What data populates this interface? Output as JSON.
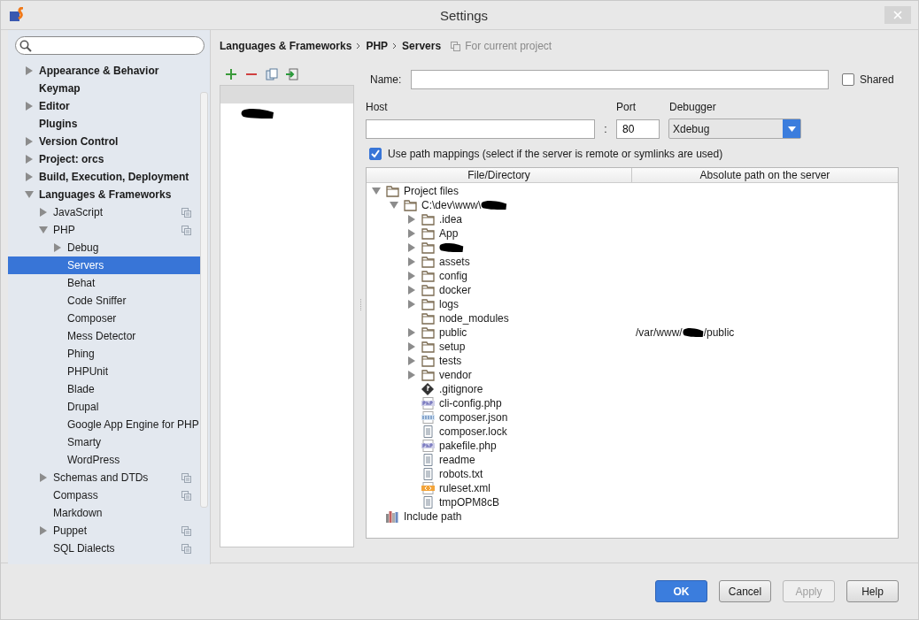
{
  "window": {
    "title": "Settings"
  },
  "sidebar": {
    "items": [
      {
        "label": "Appearance & Behavior",
        "expanded": false
      },
      {
        "label": "Keymap"
      },
      {
        "label": "Editor",
        "expanded": false
      },
      {
        "label": "Plugins"
      },
      {
        "label": "Version Control",
        "expanded": false
      },
      {
        "label": "Project: orcs",
        "expanded": false
      },
      {
        "label": "Build, Execution, Deployment",
        "expanded": false
      },
      {
        "label": "Languages & Frameworks",
        "expanded": true,
        "children": [
          {
            "label": "JavaScript",
            "expanded": false,
            "project_level": true
          },
          {
            "label": "PHP",
            "expanded": true,
            "project_level": true,
            "children": [
              {
                "label": "Debug",
                "expanded": false
              },
              {
                "label": "Servers",
                "selected": true
              },
              {
                "label": "Behat",
                "selected": false
              },
              {
                "label": "Code Sniffer",
                "selected": false
              },
              {
                "label": "Composer",
                "selected": false
              },
              {
                "label": "Mess Detector",
                "selected": false
              },
              {
                "label": "Phing",
                "selected": false
              },
              {
                "label": "PHPUnit",
                "selected": false
              },
              {
                "label": "Blade",
                "selected": false
              },
              {
                "label": "Drupal",
                "selected": false
              },
              {
                "label": "Google App Engine for PHP",
                "selected": false
              },
              {
                "label": "Smarty",
                "selected": false
              },
              {
                "label": "WordPress",
                "selected": false
              }
            ]
          },
          {
            "label": "Schemas and DTDs",
            "expanded": false,
            "project_level": true
          },
          {
            "label": "Compass",
            "project_level": true
          },
          {
            "label": "Markdown"
          },
          {
            "label": "Puppet",
            "expanded": false,
            "project_level": true
          },
          {
            "label": "SQL Dialects",
            "project_level": true
          }
        ]
      }
    ]
  },
  "breadcrumb": {
    "parts": [
      "Languages & Frameworks",
      "PHP",
      "Servers"
    ],
    "scope": "For current project"
  },
  "servers": [
    {
      "redacted": true
    }
  ],
  "form": {
    "name_label": "Name:",
    "shared": {
      "label": "Shared",
      "checked": false
    },
    "host_label": "Host",
    "colon": ":",
    "port_label": "Port",
    "port_value": "80",
    "debugger_label": "Debugger",
    "debugger_value": "Xdebug",
    "path_mappings": {
      "label": "Use path mappings (select if the server is remote or symlinks are used)",
      "checked": true
    }
  },
  "mappings_table": {
    "columns": [
      "File/Directory",
      "Absolute path on the server"
    ],
    "rows": [
      {
        "label": "Project files",
        "kind": "folder",
        "expanded": true,
        "children": [
          {
            "label": "C:\\dev\\www\\",
            "redacted": true,
            "kind": "folder",
            "expanded": true,
            "children": [
              {
                "label": ".idea",
                "kind": "folder",
                "expanded": false
              },
              {
                "label": "App",
                "kind": "folder",
                "expanded": false
              },
              {
                "redacted": true,
                "kind": "folder",
                "expanded": false
              },
              {
                "label": "assets",
                "kind": "folder",
                "expanded": false
              },
              {
                "label": "config",
                "kind": "folder",
                "expanded": false
              },
              {
                "label": "docker",
                "kind": "folder",
                "expanded": false
              },
              {
                "label": "logs",
                "kind": "folder",
                "expanded": false
              },
              {
                "label": "node_modules",
                "kind": "folder"
              },
              {
                "label": "public",
                "kind": "folder",
                "expanded": false,
                "mapping": [
                  "/var/www/",
                  "/public"
                ]
              },
              {
                "label": "setup",
                "kind": "folder",
                "expanded": false
              },
              {
                "label": "tests",
                "kind": "folder",
                "expanded": false
              },
              {
                "label": "vendor",
                "kind": "folder",
                "expanded": false
              },
              {
                "label": ".gitignore",
                "kind": "git"
              },
              {
                "label": "cli-config.php",
                "kind": "php"
              },
              {
                "label": "composer.json",
                "kind": "json"
              },
              {
                "label": "composer.lock",
                "kind": "text"
              },
              {
                "label": "pakefile.php",
                "kind": "php"
              },
              {
                "label": "readme",
                "kind": "text"
              },
              {
                "label": "robots.txt",
                "kind": "text"
              },
              {
                "label": "ruleset.xml",
                "kind": "xml"
              },
              {
                "label": "tmpOPM8cB",
                "kind": "text"
              }
            ]
          }
        ]
      },
      {
        "label": "Include path",
        "kind": "library"
      }
    ]
  },
  "buttons": [
    {
      "label": "OK",
      "kind": "primary",
      "disabled": false
    },
    {
      "label": "Cancel",
      "kind": "normal",
      "disabled": false
    },
    {
      "label": "Apply",
      "kind": "normal",
      "disabled": true
    },
    {
      "label": "Help",
      "kind": "normal",
      "disabled": false
    }
  ]
}
